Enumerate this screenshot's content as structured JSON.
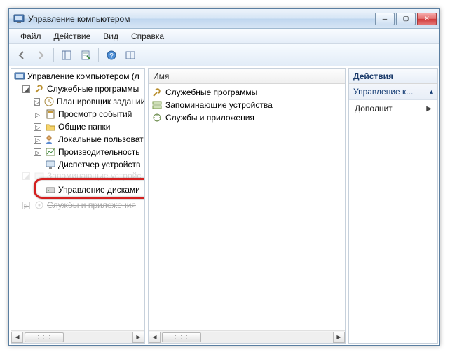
{
  "window": {
    "title": "Управление компьютером"
  },
  "menubar": {
    "file": "Файл",
    "action": "Действие",
    "view": "Вид",
    "help": "Справка"
  },
  "tree": {
    "root": "Управление компьютером (л",
    "systools": "Служебные программы",
    "scheduler": "Планировщик заданий",
    "eventviewer": "Просмотр событий",
    "sharedfolders": "Общие папки",
    "localusers": "Локальные пользоват",
    "performance": "Производительность",
    "devicemgr": "Диспетчер устройств",
    "storage_hidden": "",
    "diskmgmt": "Управление дисками",
    "services_hidden": "Службы и приложения"
  },
  "midheader": "Имя",
  "list": {
    "item0": "Служебные программы",
    "item1": "Запоминающие устройства",
    "item2": "Службы и приложения"
  },
  "actions": {
    "header": "Действия",
    "group": "Управление к...",
    "more": "Дополнит"
  }
}
